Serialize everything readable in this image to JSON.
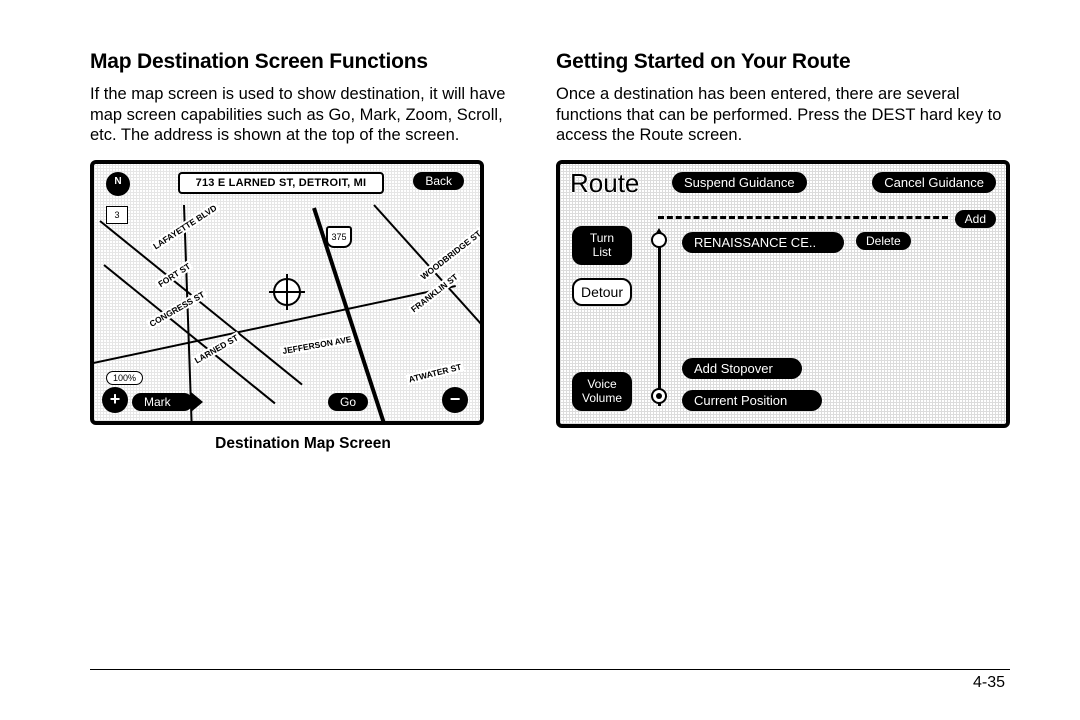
{
  "left": {
    "heading": "Map Destination Screen Functions",
    "paragraph": "If the map screen is used to show destination, it will have map screen capabilities such as Go, Mark, Zoom, Scroll, etc. The address is shown at the top of the screen.",
    "figure_caption": "Destination Map Screen",
    "map": {
      "address": "713 E LARNED ST, DETROIT, MI",
      "compass": "N",
      "scale_chip": "3",
      "zoom_chip": "100%",
      "highway": "375",
      "back": "Back",
      "mark": "Mark",
      "go": "Go",
      "plus": "+",
      "minus": "−",
      "streets": {
        "lafayette": "LAFAYETTE BLVD",
        "fort": "FORT ST",
        "congress": "CONGRESS ST",
        "larned": "LARNED ST",
        "jefferson": "JEFFERSON AVE",
        "woodbridge": "WOODBRIDGE ST",
        "franklin": "FRANKLIN ST",
        "atwater": "ATWATER ST"
      }
    }
  },
  "right": {
    "heading": "Getting Started on Your Route",
    "paragraph": "Once a destination has been entered, there are several functions that can be performed. Press the DEST hard key to access the Route screen.",
    "route": {
      "title": "Route",
      "suspend": "Suspend Guidance",
      "cancel": "Cancel Guidance",
      "add": "Add",
      "destination": "RENAISSANCE CE..",
      "delete": "Delete",
      "turn_list": "Turn\nList",
      "detour": "Detour",
      "voice": "Voice\nVolume",
      "add_stopover": "Add Stopover",
      "current_position": "Current Position"
    }
  },
  "page_number": "4-35"
}
